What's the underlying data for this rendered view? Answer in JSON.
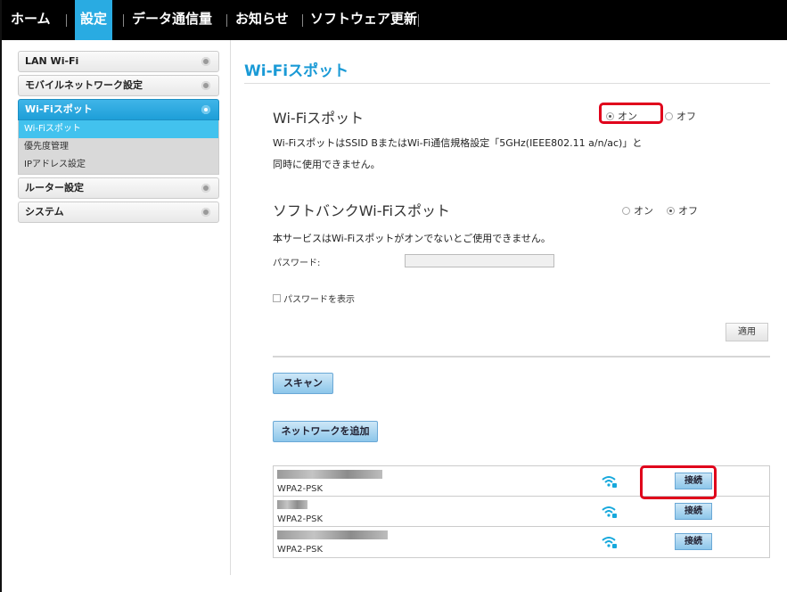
{
  "nav": {
    "items": [
      "ホーム",
      "設定",
      "データ通信量",
      "お知らせ",
      "ソフトウェア更新"
    ],
    "active": "設定"
  },
  "sidebar": {
    "items": [
      {
        "label": "LAN Wi-Fi"
      },
      {
        "label": "モバイルネットワーク設定"
      },
      {
        "label": "Wi-Fiスポット"
      },
      {
        "label": "ルーター設定"
      },
      {
        "label": "システム"
      }
    ],
    "sub_items": [
      "Wi-Fiスポット",
      "優先度管理",
      "IPアドレス設定"
    ]
  },
  "page": {
    "title": "Wi-Fiスポット"
  },
  "wifi_spot": {
    "title": "Wi-Fiスポット",
    "on_label": "オン",
    "off_label": "オフ",
    "selected": "オン",
    "note_line1": "Wi-FiスポットはSSID BまたはWi-Fi通信規格設定「5GHz(IEEE802.11 a/n/ac)」と",
    "note_line2": "同時に使用できません。"
  },
  "softbank_spot": {
    "title": "ソフトバンクWi-Fiスポット",
    "on_label": "オン",
    "off_label": "オフ",
    "selected": "オフ",
    "note": "本サービスはWi-Fiスポットがオンでないとご使用できません。",
    "password_label": "パスワード:",
    "password_value": "",
    "show_password_label": "パスワードを表示"
  },
  "buttons": {
    "apply": "適用",
    "scan": "スキャン",
    "add_network": "ネットワークを追加",
    "connect": "接続"
  },
  "networks": [
    {
      "ssid": "",
      "security": "WPA2-PSK"
    },
    {
      "ssid": "",
      "security": "WPA2-PSK"
    },
    {
      "ssid": "",
      "security": "WPA2-PSK"
    }
  ],
  "colors": {
    "accent": "#29abe2",
    "highlight": "#e0001b",
    "wifi_icon": "#16a8dc"
  }
}
